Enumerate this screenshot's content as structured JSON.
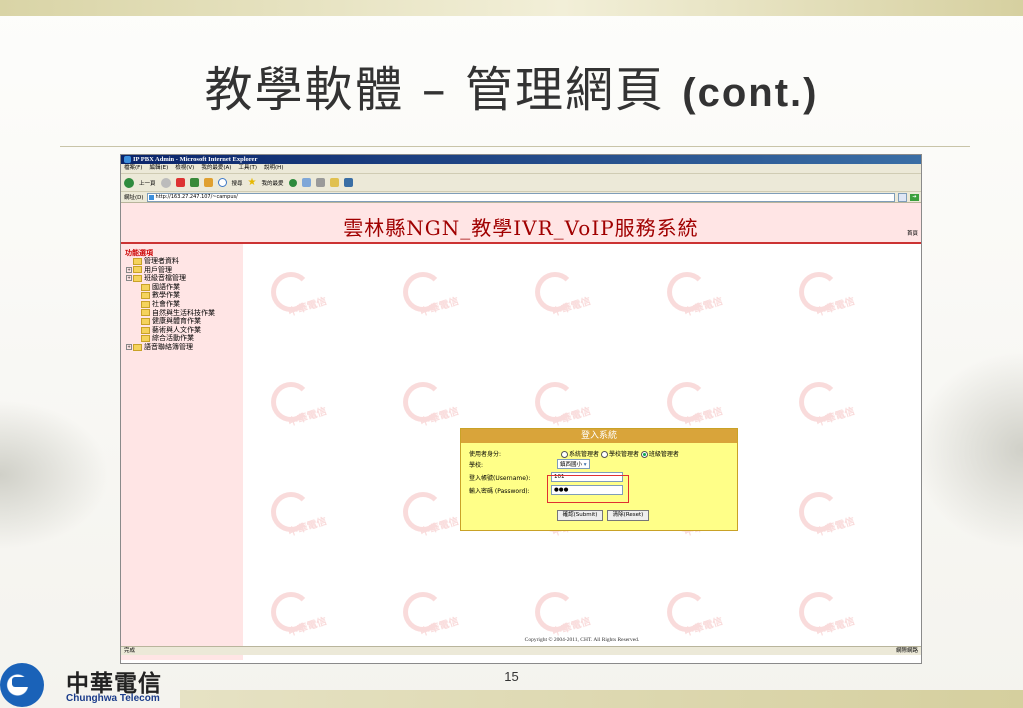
{
  "slide": {
    "title_main": "教學軟體 – 管理網頁 ",
    "title_cont": "(cont.)",
    "page_number": "15"
  },
  "logo": {
    "name_zh": "中華電信",
    "name_en": "Chunghwa Telecom"
  },
  "browser": {
    "window_title": "IP PBX Admin - Microsoft Internet Explorer",
    "menu": [
      "檔案(F)",
      "編輯(E)",
      "檢視(V)",
      "我的最愛(A)",
      "工具(T)",
      "說明(H)"
    ],
    "toolbar": {
      "back_label": "上一頁",
      "search_label": "搜尋",
      "favorites_label": "我的最愛"
    },
    "address_label": "網址(D)",
    "address_value": "http://163.27.247.107/~campus/",
    "status_left": "完成",
    "status_right": "網際網路"
  },
  "site": {
    "header_title": "雲林縣NGN_教學IVR_VoIP服務系統",
    "home_link": "首頁",
    "sidebar": {
      "heading": "功能選項",
      "items": [
        {
          "label": "管理者資料",
          "level": 1,
          "expandable": false
        },
        {
          "label": "用戶管理",
          "level": 0,
          "expandable": true
        },
        {
          "label": "班級音檔管理",
          "level": 0,
          "expandable": true
        },
        {
          "label": "國語作業",
          "level": 2,
          "expandable": false
        },
        {
          "label": "數學作業",
          "level": 2,
          "expandable": false
        },
        {
          "label": "社會作業",
          "level": 2,
          "expandable": false
        },
        {
          "label": "自然與生活科技作業",
          "level": 2,
          "expandable": false
        },
        {
          "label": "健康與體育作業",
          "level": 2,
          "expandable": false
        },
        {
          "label": "藝術與人文作業",
          "level": 2,
          "expandable": false
        },
        {
          "label": "綜合活動作業",
          "level": 2,
          "expandable": false
        },
        {
          "label": "語音聯絡簿管理",
          "level": 0,
          "expandable": true
        }
      ]
    },
    "login": {
      "heading": "登入系統",
      "role_label": "使用者身分:",
      "roles": [
        {
          "label": "系統管理者",
          "selected": false
        },
        {
          "label": "學校管理者",
          "selected": false
        },
        {
          "label": "班級管理者",
          "selected": true
        }
      ],
      "school_label": "學校:",
      "school_value": "鎮西國小",
      "username_label": "登入帳號(Username):",
      "username_value": "101",
      "password_label": "輸入密碼 (Password):",
      "password_value": "●●●",
      "submit_label": "確認(Submit)",
      "reset_label": "清除(Reset)"
    },
    "copyright": "Copyright © 2004-2011, CHT. All Rights Reserved."
  }
}
